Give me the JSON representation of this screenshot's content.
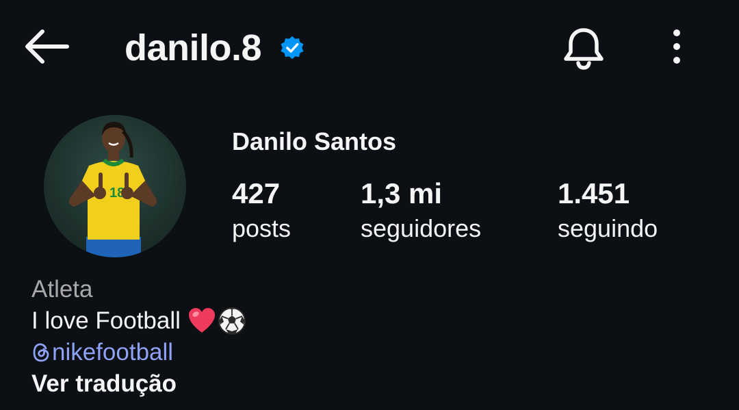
{
  "header": {
    "username": "danilo.8",
    "verified": true,
    "icons": [
      "arrow-left-icon",
      "verified-badge-icon",
      "bell-icon",
      "more-vertical-icon"
    ]
  },
  "profile": {
    "full_name": "Danilo Santos",
    "avatar": "profile-photo-player-in-yellow-jersey"
  },
  "stats": [
    {
      "value": "427",
      "label": "posts"
    },
    {
      "value": "1,3 mi",
      "label": "seguidores"
    },
    {
      "value": "1.451",
      "label": "seguindo"
    }
  ],
  "bio": {
    "category": "Atleta",
    "text": "I love Football",
    "emojis": [
      "heart-emoji",
      "soccer-ball-emoji"
    ],
    "link": "nikefootball",
    "link_icon": "threads-icon",
    "translate_label": "Ver tradução"
  },
  "colors": {
    "background": "#0c1014",
    "text": "#f5f5f5",
    "muted": "#a8a8a8",
    "link": "#8fa2f5",
    "verified": "#0095f6"
  }
}
